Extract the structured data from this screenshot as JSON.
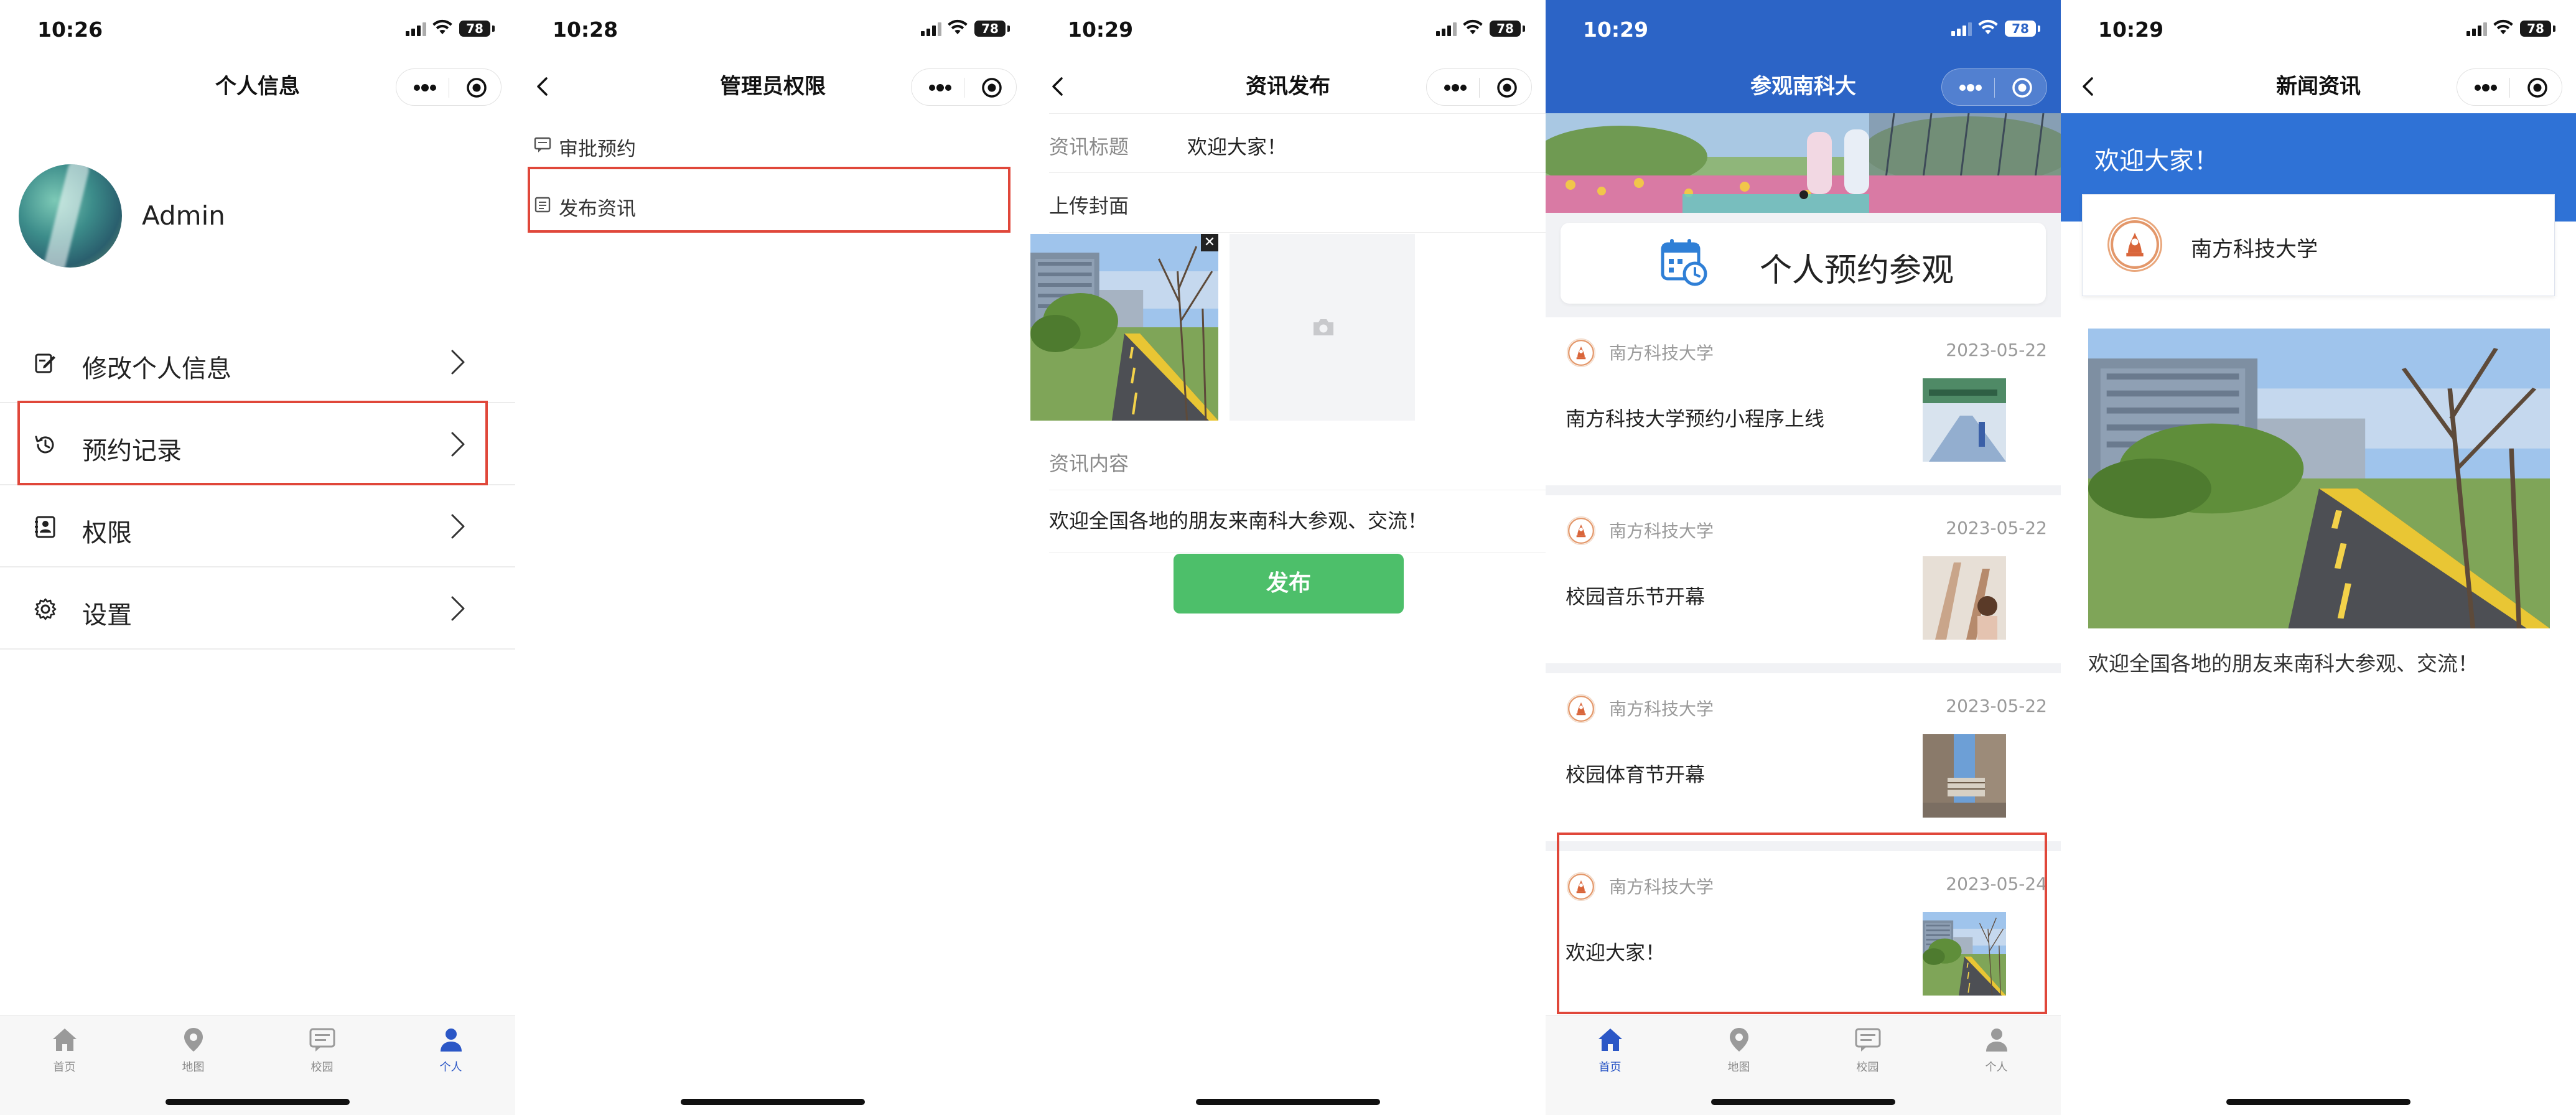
{
  "colors": {
    "highlight": "#e0473a",
    "brand_blue": "#2c64c6",
    "publish_green": "#4dbf6a",
    "tab_active": "#2b57c6"
  },
  "status": {
    "battery": "78"
  },
  "tabs": [
    {
      "label": "首页",
      "icon": "home-icon"
    },
    {
      "label": "地图",
      "icon": "map-pin-icon"
    },
    {
      "label": "校园",
      "icon": "chat-icon"
    },
    {
      "label": "个人",
      "icon": "person-icon"
    }
  ],
  "screen1": {
    "time": "10:26",
    "title": "个人信息",
    "username": "Admin",
    "menu": [
      {
        "label": "修改个人信息",
        "icon": "edit-icon"
      },
      {
        "label": "预约记录",
        "icon": "history-icon"
      },
      {
        "label": "权限",
        "icon": "permission-icon"
      },
      {
        "label": "设置",
        "icon": "gear-icon"
      }
    ],
    "highlighted": "预约记录",
    "active_tab": "个人"
  },
  "screen2": {
    "time": "10:28",
    "title": "管理员权限",
    "items": [
      {
        "label": "审批预约",
        "icon": "message-icon"
      },
      {
        "label": "发布资讯",
        "icon": "document-icon"
      }
    ],
    "highlighted": "发布资讯"
  },
  "screen3": {
    "time": "10:29",
    "title": "资讯发布",
    "title_label": "资讯标题",
    "title_value": "欢迎大家！",
    "cover_label": "上传封面",
    "content_label": "资讯内容",
    "content_value": "欢迎全国各地的朋友来南科大参观、交流！",
    "publish_label": "发布"
  },
  "screen4": {
    "time": "10:29",
    "title": "参观南科大",
    "booking_label": "个人预约参观",
    "news": [
      {
        "source": "南方科技大学",
        "date": "2023-05-22",
        "title": "南方科技大学预约小程序上线"
      },
      {
        "source": "南方科技大学",
        "date": "2023-05-22",
        "title": "校园音乐节开幕"
      },
      {
        "source": "南方科技大学",
        "date": "2023-05-22",
        "title": "校园体育节开幕"
      },
      {
        "source": "南方科技大学",
        "date": "2023-05-24",
        "title": "欢迎大家！"
      }
    ],
    "active_tab": "首页"
  },
  "screen5": {
    "time": "10:29",
    "title": "新闻资讯",
    "headline": "欢迎大家！",
    "source": "南方科技大学",
    "body": "欢迎全国各地的朋友来南科大参观、交流！"
  }
}
